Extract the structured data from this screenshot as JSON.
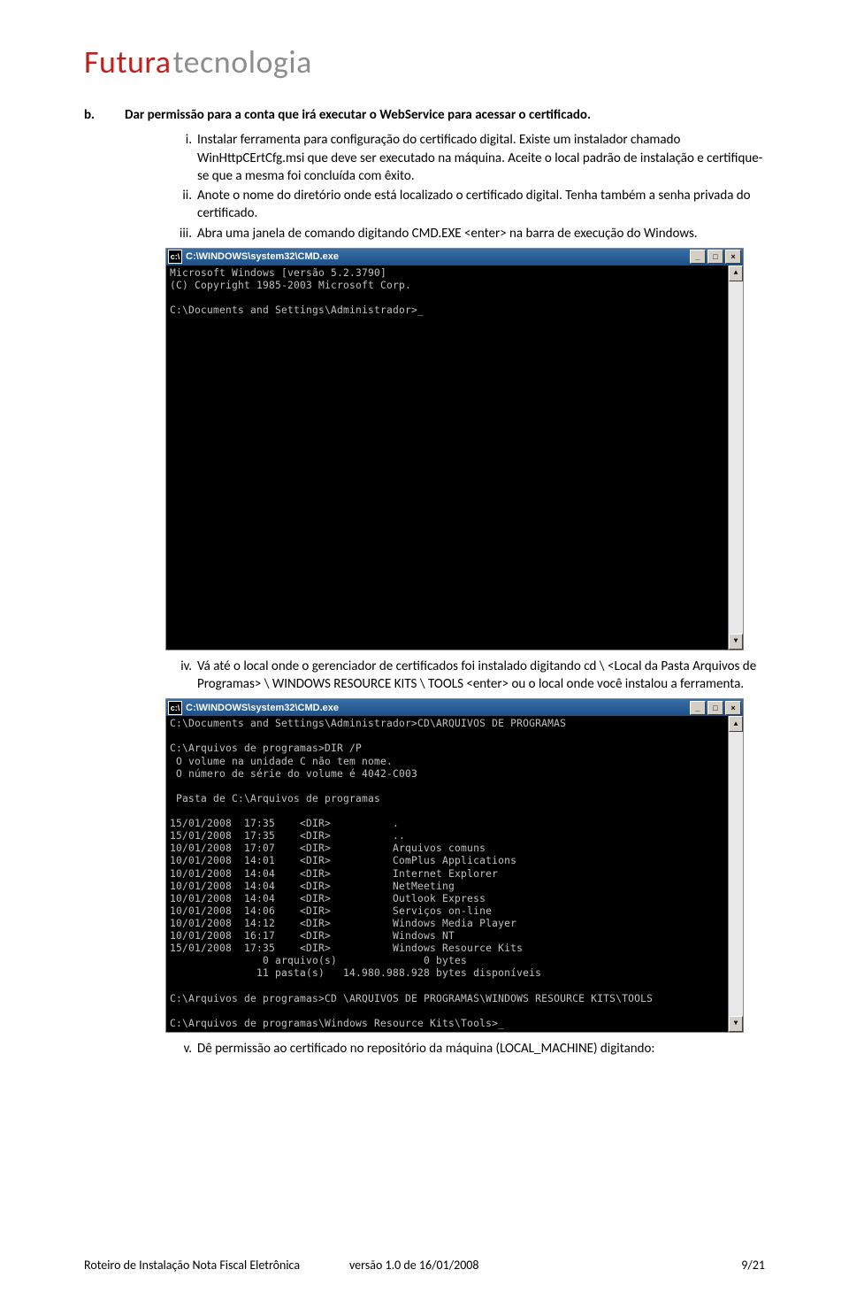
{
  "logo": {
    "part1": "Futura",
    "part2": "tecnologia"
  },
  "section_b": {
    "label": "b.",
    "title": "Dar permissão para a conta que irá executar o WebService para acessar o certificado."
  },
  "items": {
    "i": {
      "n": "i.",
      "text": "Instalar ferramenta para configuração do certificado digital. Existe um instalador chamado WinHttpCErtCfg.msi que deve ser executado na máquina. Aceite o local padrão de instalação e certifique-se que a mesma foi concluída com êxito."
    },
    "ii": {
      "n": "ii.",
      "text": "Anote o nome do diretório onde está localizado o certificado digital. Tenha também a senha privada do certificado."
    },
    "iii": {
      "n": "iii.",
      "text": "Abra uma janela de comando digitando CMD.EXE <enter> na barra de execução do Windows."
    },
    "iv": {
      "n": "iv.",
      "text": "Vá até o local onde o gerenciador de certificados foi instalado digitando cd \\ <Local da Pasta Arquivos de Programas> \\ WINDOWS RESOURCE KITS \\ TOOLS <enter>  ou o local onde você instalou a ferramenta."
    },
    "v": {
      "n": "v.",
      "text": "Dê permissão ao certificado no repositório da máquina (LOCAL_MACHINE) digitando:"
    }
  },
  "cmd1": {
    "title": "C:\\WINDOWS\\system32\\CMD.exe",
    "content": "Microsoft Windows [versão 5.2.3790]\n(C) Copyright 1985-2003 Microsoft Corp.\n\nC:\\Documents and Settings\\Administrador>_"
  },
  "cmd2": {
    "title": "C:\\WINDOWS\\system32\\CMD.exe",
    "content": "C:\\Documents and Settings\\Administrador>CD\\ARQUIVOS DE PROGRAMAS\n\nC:\\Arquivos de programas>DIR /P\n O volume na unidade C não tem nome.\n O número de série do volume é 4042-C003\n\n Pasta de C:\\Arquivos de programas\n\n15/01/2008  17:35    <DIR>          .\n15/01/2008  17:35    <DIR>          ..\n10/01/2008  17:07    <DIR>          Arquivos comuns\n10/01/2008  14:01    <DIR>          ComPlus Applications\n10/01/2008  14:04    <DIR>          Internet Explorer\n10/01/2008  14:04    <DIR>          NetMeeting\n10/01/2008  14:04    <DIR>          Outlook Express\n10/01/2008  14:06    <DIR>          Serviços on-line\n10/01/2008  14:12    <DIR>          Windows Media Player\n10/01/2008  16:17    <DIR>          Windows NT\n15/01/2008  17:35    <DIR>          Windows Resource Kits\n               0 arquivo(s)              0 bytes\n              11 pasta(s)   14.980.988.928 bytes disponíveis\n\nC:\\Arquivos de programas>CD \\ARQUIVOS DE PROGRAMAS\\WINDOWS RESOURCE KITS\\TOOLS\n\nC:\\Arquivos de programas\\Windows Resource Kits\\Tools>_"
  },
  "win_buttons": {
    "min": "_",
    "max": "□",
    "close": "×",
    "up": "▲",
    "down": "▼",
    "icon": "c:\\"
  },
  "footer": {
    "left": "Roteiro de Instalação Nota Fiscal Eletrônica",
    "center": "versão 1.0 de 16/01/2008",
    "right": "9/21"
  }
}
